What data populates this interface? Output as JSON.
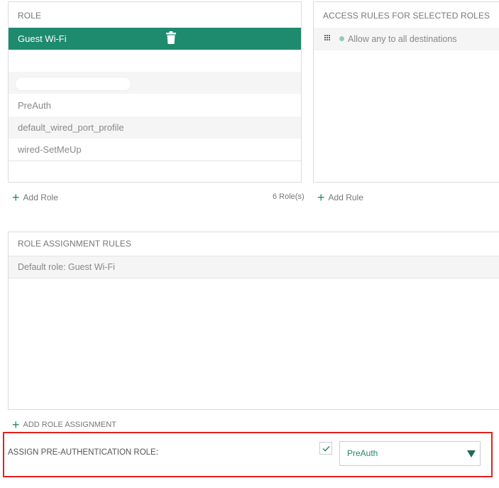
{
  "roles_panel": {
    "header": "ROLE",
    "selected_role": "Guest Wi-Fi",
    "rename_value": "",
    "roles": [
      "PreAuth",
      "default_wired_port_profile",
      "wired-SetMeUp"
    ],
    "add_label": "Add Role",
    "count_label": "6 Role(s)"
  },
  "access_rules_panel": {
    "header": "ACCESS RULES FOR SELECTED ROLES",
    "rules": [
      "Allow any to all destinations"
    ],
    "add_label": "Add Rule"
  },
  "assignment_panel": {
    "header": "ROLE ASSIGNMENT RULES",
    "default_role": "Default role: Guest Wi-Fi",
    "add_label": "ADD ROLE ASSIGNMENT"
  },
  "preauth": {
    "label": "ASSIGN PRE-AUTHENTICATION ROLE:",
    "checked": true,
    "selected_value": "PreAuth"
  },
  "colors": {
    "accent": "#1e8a6e",
    "highlight": "#e32020",
    "rule_dot": "#8fcdb6"
  },
  "icons": [
    "trash-icon",
    "plus-icon",
    "drag-handle-icon",
    "check-icon",
    "caret-down-icon"
  ]
}
